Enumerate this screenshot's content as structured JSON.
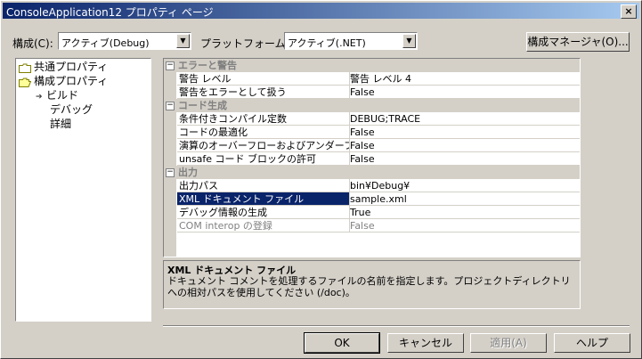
{
  "window": {
    "title": "ConsoleApplication12 プロパティ ページ",
    "close": "×"
  },
  "config": {
    "config_label": "構成(C):",
    "config_value": "アクティブ(Debug)",
    "platform_label": "プラットフォーム(P):",
    "platform_value": "アクティブ(.NET)",
    "manager_button": "構成マネージャ(O)..."
  },
  "tree": {
    "items": [
      {
        "label": "共通プロパティ"
      },
      {
        "label": "構成プロパティ"
      },
      {
        "label": "ビルド"
      },
      {
        "label": "デバッグ"
      },
      {
        "label": "詳細"
      }
    ]
  },
  "grid": {
    "categories": [
      {
        "name": "エラーと警告",
        "toggle": "⊟"
      },
      {
        "name": "コード生成",
        "toggle": "⊟"
      },
      {
        "name": "出力",
        "toggle": "⊟"
      }
    ],
    "rows": [
      {
        "name": "警告 レベル",
        "value": "警告 レベル 4"
      },
      {
        "name": "警告をエラーとして扱う",
        "value": "False"
      },
      {
        "name": "条件付きコンパイル定数",
        "value": "DEBUG;TRACE"
      },
      {
        "name": "コードの最適化",
        "value": "False"
      },
      {
        "name": "演算のオーバーフローおよびアンダーフロ",
        "value": "False"
      },
      {
        "name": "unsafe コード ブロックの許可",
        "value": "False"
      },
      {
        "name": "出力パス",
        "value": "bin¥Debug¥"
      },
      {
        "name": "XML ドキュメント ファイル",
        "value": "sample.xml"
      },
      {
        "name": "デバッグ情報の生成",
        "value": "True"
      },
      {
        "name": "COM interop の登録",
        "value": "False"
      }
    ]
  },
  "description": {
    "title": "XML ドキュメント ファイル",
    "body": "ドキュメント コメントを処理するファイルの名前を指定します。プロジェクトディレクトリへの相対パスを使用してください (/doc)。"
  },
  "buttons": {
    "ok": "OK",
    "cancel": "キャンセル",
    "apply": "適用(A)",
    "help": "ヘルプ"
  },
  "colors": {
    "titlebar": "#0a246a",
    "selection": "#0a246a",
    "face": "#d4d0c8"
  }
}
